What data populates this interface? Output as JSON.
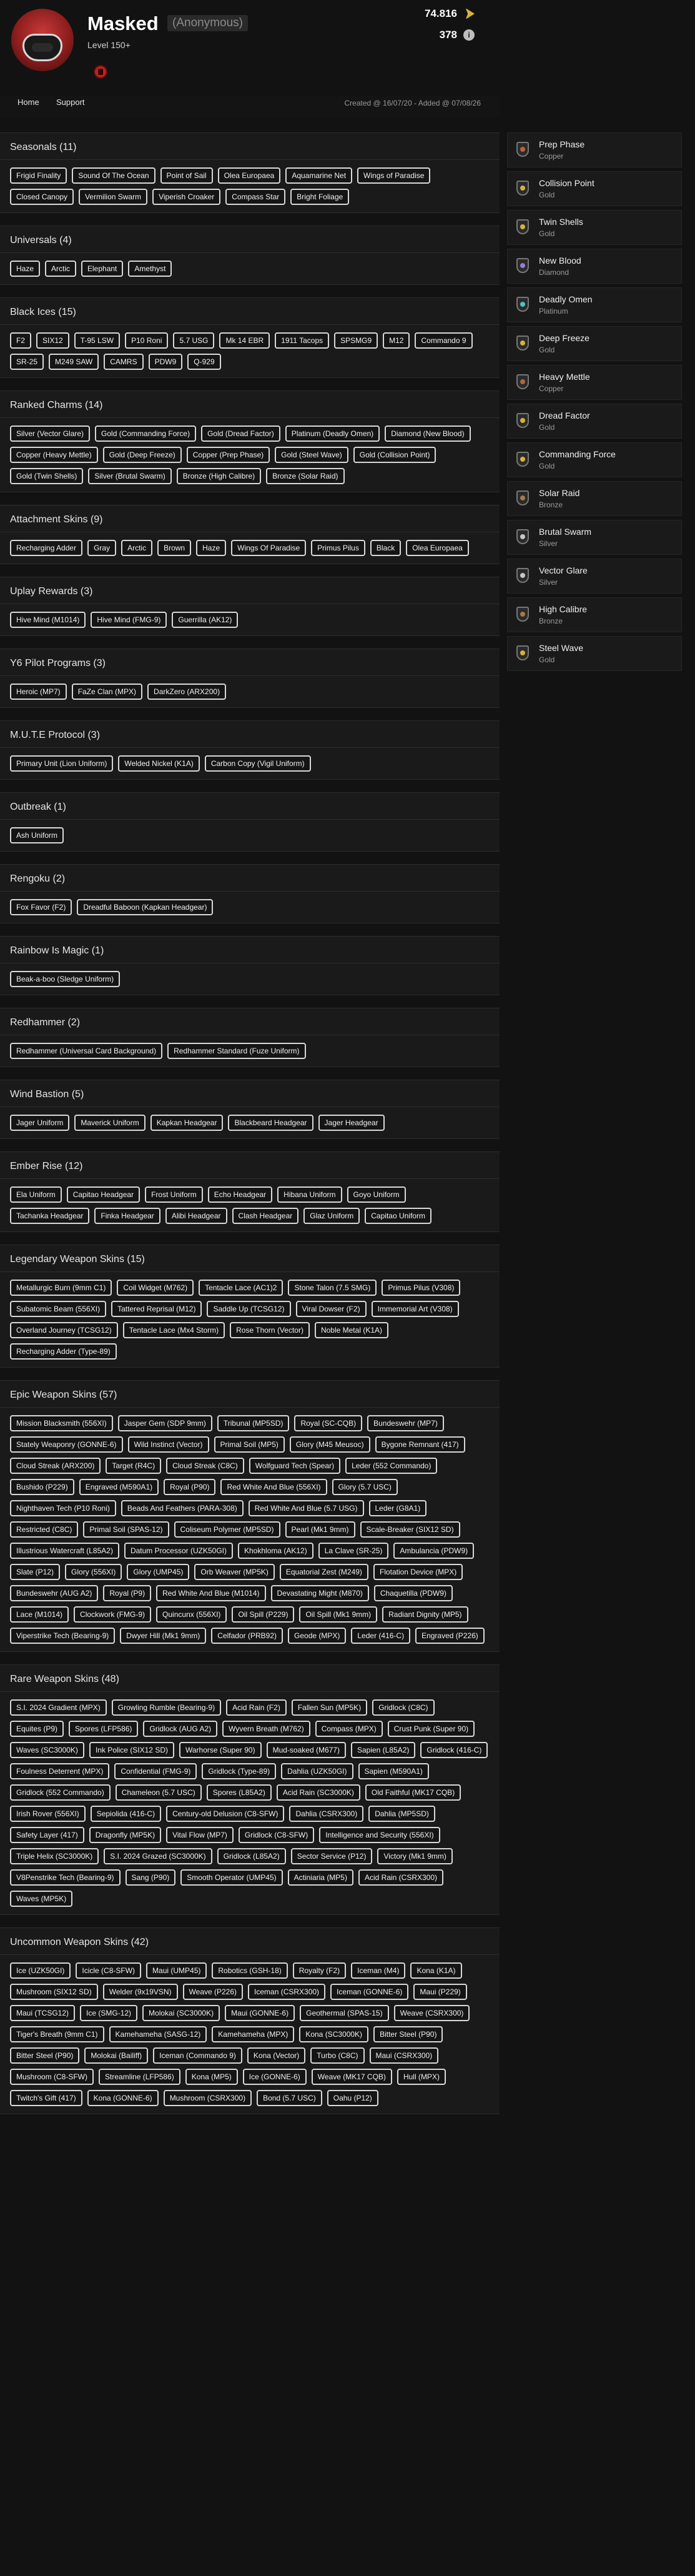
{
  "profile": {
    "name": "Masked",
    "anonymous_label": "(Anonymous)",
    "level": "Level 150+",
    "renown": "74.816",
    "info_count": "378"
  },
  "nav": {
    "home": "Home",
    "support": "Support",
    "created": "Created @ 16/07/20 - Added @ 07/08/26"
  },
  "sections": [
    {
      "title": "Seasonals (11)",
      "items": [
        "Frigid Finality",
        "Sound Of The Ocean",
        "Point of Sail",
        "Olea Europaea",
        "Aquamarine Net",
        "Wings of Paradise",
        "Closed Canopy",
        "Vermilion Swarm",
        "Viperish Croaker",
        "Compass Star",
        "Bright Foliage"
      ]
    },
    {
      "title": "Universals (4)",
      "items": [
        "Haze",
        "Arctic",
        "Elephant",
        "Amethyst"
      ]
    },
    {
      "title": "Black Ices (15)",
      "items": [
        "F2",
        "SIX12",
        "T-95 LSW",
        "P10 Roni",
        "5.7 USG",
        "Mk 14 EBR",
        "1911 Tacops",
        "SPSMG9",
        "M12",
        "Commando 9",
        "SR-25",
        "M249 SAW",
        "CAMRS",
        "PDW9",
        "Q-929"
      ]
    },
    {
      "title": "Ranked Charms (14)",
      "items": [
        "Silver (Vector Glare)",
        "Gold (Commanding Force)",
        "Gold (Dread Factor)",
        "Platinum (Deadly Omen)",
        "Diamond (New Blood)",
        "Copper (Heavy Mettle)",
        "Gold (Deep Freeze)",
        "Copper (Prep Phase)",
        "Gold (Steel Wave)",
        "Gold (Collision Point)",
        "Gold (Twin Shells)",
        "Silver (Brutal Swarm)",
        "Bronze (High Calibre)",
        "Bronze (Solar Raid)"
      ]
    },
    {
      "title": "Attachment Skins (9)",
      "items": [
        "Recharging Adder",
        "Gray",
        "Arctic",
        "Brown",
        "Haze",
        "Wings Of Paradise",
        "Primus Pilus",
        "Black",
        "Olea Europaea"
      ]
    },
    {
      "title": "Uplay Rewards (3)",
      "items": [
        "Hive Mind (M1014)",
        "Hive Mind (FMG-9)",
        "Guerrilla (AK12)"
      ]
    },
    {
      "title": "Y6 Pilot Programs (3)",
      "items": [
        "Heroic (MP7)",
        "FaZe Clan (MPX)",
        "DarkZero (ARX200)"
      ]
    },
    {
      "title": "M.U.T.E Protocol (3)",
      "items": [
        "Primary Unit (Lion Uniform)",
        "Welded Nickel (K1A)",
        "Carbon Copy (Vigil Uniform)"
      ]
    },
    {
      "title": "Outbreak (1)",
      "items": [
        "Ash Uniform"
      ]
    },
    {
      "title": "Rengoku (2)",
      "items": [
        "Fox Favor (F2)",
        "Dreadful Baboon (Kapkan Headgear)"
      ]
    },
    {
      "title": "Rainbow Is Magic (1)",
      "items": [
        "Beak-a-boo (Sledge Uniform)"
      ]
    },
    {
      "title": "Redhammer (2)",
      "items": [
        "Redhammer (Universal Card Background)",
        "Redhammer Standard (Fuze Uniform)"
      ]
    },
    {
      "title": "Wind Bastion (5)",
      "items": [
        "Jager Uniform",
        "Maverick Uniform",
        "Kapkan Headgear",
        "Blackbeard Headgear",
        "Jager Headgear"
      ]
    },
    {
      "title": "Ember Rise (12)",
      "items": [
        "Ela Uniform",
        "Capitao Headgear",
        "Frost Uniform",
        "Echo Headgear",
        "Hibana Uniform",
        "Goyo Uniform",
        "Tachanka Headgear",
        "Finka Headgear",
        "Alibi Headgear",
        "Clash Headgear",
        "Glaz Uniform",
        "Capitao Uniform"
      ]
    },
    {
      "title": "Legendary Weapon Skins (15)",
      "items": [
        "Metallurgic Burn (9mm C1)",
        "Coil Widget (M762)",
        "Tentacle Lace (AC1)2",
        "Stone Talon (7.5 SMG)",
        "Primus Pilus (V308)",
        "Subatomic Beam (556XI)",
        "Tattered Reprisal (M12)",
        "Saddle Up (TCSG12)",
        "Viral Dowser (F2)",
        "Immemorial Art (V308)",
        "Overland Journey (TCSG12)",
        "Tentacle Lace (Mx4 Storm)",
        "Rose Thorn (Vector)",
        "Noble Metal (K1A)",
        "Recharging Adder (Type-89)"
      ]
    },
    {
      "title": "Epic Weapon Skins (57)",
      "items": [
        "Mission Blacksmith (556XI)",
        "Jasper Gem (SDP 9mm)",
        "Tribunal (MP5SD)",
        "Royal (SC-CQB)",
        "Bundeswehr (MP7)",
        "Stately Weaponry (GONNE-6)",
        "Wild Instinct (Vector)",
        "Primal Soil (MP5)",
        "Glory (M45 Meusoc)",
        "Bygone Remnant (417)",
        "Cloud Streak (ARX200)",
        "Target (R4C)",
        "Cloud Streak (C8C)",
        "Wolfguard Tech (Spear)",
        "Leder (552 Commando)",
        "Bushido (P229)",
        "Engraved (M590A1)",
        "Royal (P90)",
        "Red White And Blue (556XI)",
        "Glory (5.7 USC)",
        "Nighthaven Tech (P10 Roni)",
        "Beads And Feathers (PARA-308)",
        "Red White And Blue (5.7 USG)",
        "Leder (G8A1)",
        "Restricted (C8C)",
        "Primal Soil (SPAS-12)",
        "Coliseum Polymer (MP5SD)",
        "Pearl (Mk1 9mm)",
        "Scale-Breaker (SIX12 SD)",
        "Illustrious Watercraft (L85A2)",
        "Datum Processor (UZK50GI)",
        "Khokhloma (AK12)",
        "La Clave (SR-25)",
        "Ambulancia (PDW9)",
        "Slate (P12)",
        "Glory (556XI)",
        "Glory (UMP45)",
        "Orb Weaver (MP5K)",
        "Equatorial Zest (M249)",
        "Flotation Device (MPX)",
        "Bundeswehr (AUG A2)",
        "Royal (P9)",
        "Red White And Blue (M1014)",
        "Devastating Might (M870)",
        "Chaquetilla (PDW9)",
        "Lace (M1014)",
        "Clockwork (FMG-9)",
        "Quincunx (556XI)",
        "Oil Spill (P229)",
        "Oil Spill (Mk1 9mm)",
        "Radiant Dignity (MP5)",
        "Viperstrike Tech (Bearing-9)",
        "Dwyer Hill (Mk1 9mm)",
        "Celfador (PRB92)",
        "Geode (MPX)",
        "Leder (416-C)",
        "Engraved (P226)"
      ]
    },
    {
      "title": "Rare Weapon Skins (48)",
      "items": [
        "S.I. 2024 Gradient (MPX)",
        "Growling Rumble (Bearing-9)",
        "Acid Rain (F2)",
        "Fallen Sun (MP5K)",
        "Gridlock (C8C)",
        "Equites (P9)",
        "Spores (LFP586)",
        "Gridlock (AUG A2)",
        "Wyvern Breath (M762)",
        "Compass (MPX)",
        "Crust Punk (Super 90)",
        "Waves (SC3000K)",
        "Ink Police (SIX12 SD)",
        "Warhorse (Super 90)",
        "Mud-soaked (M677)",
        "Sapien (L85A2)",
        "Gridlock (416-C)",
        "Foulness Deterrent (MPX)",
        "Confidential (FMG-9)",
        "Gridlock (Type-89)",
        "Dahlia (UZK50GI)",
        "Sapien (M590A1)",
        "Gridlock (552 Commando)",
        "Chameleon (5.7 USC)",
        "Spores (L85A2)",
        "Acid Rain (SC3000K)",
        "Old Faithful (MK17 CQB)",
        "Irish Rover (556XI)",
        "Sepiolida (416-C)",
        "Century-old Delusion (C8-SFW)",
        "Dahlia (CSRX300)",
        "Dahlia (MP5SD)",
        "Safety Layer (417)",
        "Dragonfly (MP5K)",
        "Vital Flow (MP7)",
        "Gridlock (C8-SFW)",
        "Intelligence and Security (556XI)",
        "Triple Helix (SC3000K)",
        "S.I. 2024 Grazed (SC3000K)",
        "Gridlock (L85A2)",
        "Sector Service (P12)",
        "Victory (Mk1 9mm)",
        "V8Penstrike Tech (Bearing-9)",
        "Sang (P90)",
        "Smooth Operator (UMP45)",
        "Actiniaria (MP5)",
        "Acid Rain (CSRX300)",
        "Waves (MP5K)"
      ]
    },
    {
      "title": "Uncommon Weapon Skins (42)",
      "items": [
        "Ice (UZK50GI)",
        "Icicle (C8-SFW)",
        "Maui (UMP45)",
        "Robotics (GSH-18)",
        "Royalty (F2)",
        "Iceman (M4)",
        "Kona (K1A)",
        "Mushroom (SIX12 SD)",
        "Welder (9x19VSN)",
        "Weave (P226)",
        "Iceman (CSRX300)",
        "Iceman (GONNE-6)",
        "Maui (P229)",
        "Maui (TCSG12)",
        "Ice (SMG-12)",
        "Molokai (SC3000K)",
        "Maui (GONNE-6)",
        "Geothermal (SPAS-15)",
        "Weave (CSRX300)",
        "Tiger's Breath (9mm C1)",
        "Kamehameha (SASG-12)",
        "Kamehameha (MPX)",
        "Kona (SC3000K)",
        "Bitter Steel (P90)",
        "Bitter Steel (P90)",
        "Molokai (Bailiff)",
        "Iceman (Commando 9)",
        "Kona (Vector)",
        "Turbo (C8C)",
        "Maui (CSRX300)",
        "Mushroom (C8-SFW)",
        "Streamline (LFP586)",
        "Kona (MP5)",
        "Ice (GONNE-6)",
        "Weave (MK17 CQB)",
        "Hull (MPX)",
        "Twitch's Gift (417)",
        "Kona (GONNE-6)",
        "Mushroom (CSRX300)",
        "Bond (5.7 USC)",
        "Oahu (P12)"
      ]
    }
  ],
  "charms": [
    {
      "name": "Prep Phase",
      "tier": "Copper",
      "color": "#b5653a"
    },
    {
      "name": "Collision Point",
      "tier": "Gold",
      "color": "#d6b23d"
    },
    {
      "name": "Twin Shells",
      "tier": "Gold",
      "color": "#d6b23d"
    },
    {
      "name": "New Blood",
      "tier": "Diamond",
      "color": "#9b7bd8"
    },
    {
      "name": "Deadly Omen",
      "tier": "Platinum",
      "color": "#4fc3c3"
    },
    {
      "name": "Deep Freeze",
      "tier": "Gold",
      "color": "#d6b23d"
    },
    {
      "name": "Heavy Mettle",
      "tier": "Copper",
      "color": "#b5653a"
    },
    {
      "name": "Dread Factor",
      "tier": "Gold",
      "color": "#d6b23d"
    },
    {
      "name": "Commanding Force",
      "tier": "Gold",
      "color": "#d6b23d"
    },
    {
      "name": "Solar Raid",
      "tier": "Bronze",
      "color": "#a77a4a"
    },
    {
      "name": "Brutal Swarm",
      "tier": "Silver",
      "color": "#c7c7c7"
    },
    {
      "name": "Vector Glare",
      "tier": "Silver",
      "color": "#c7c7c7"
    },
    {
      "name": "High Calibre",
      "tier": "Bronze",
      "color": "#a77a4a"
    },
    {
      "name": "Steel Wave",
      "tier": "Gold",
      "color": "#d6b23d"
    }
  ]
}
